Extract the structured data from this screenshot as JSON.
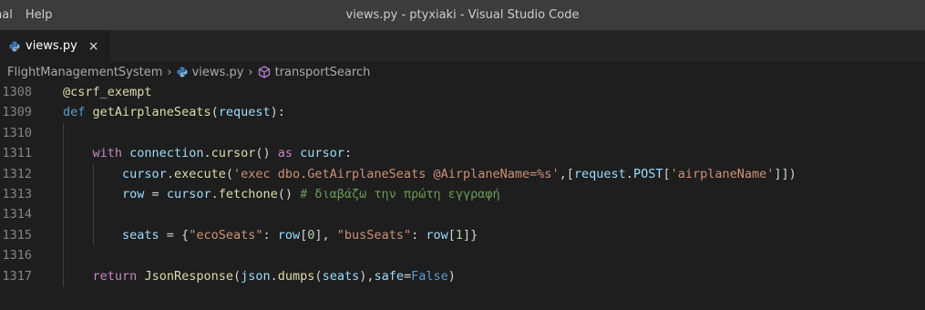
{
  "menu": [
    "nal",
    "Help"
  ],
  "window_title": "views.py - ptyxiaki - Visual Studio Code",
  "tab": {
    "label": "views.py",
    "close": "×"
  },
  "breadcrumb": {
    "folder": "FlightManagementSystem",
    "file": "views.py",
    "symbol": "transportSearch"
  },
  "colors": {
    "titlebar": "#3c3c3c",
    "editor_bg": "#1e1e1e",
    "python_icon": "#3a7cbf"
  },
  "code_lines": [
    {
      "num": "1308",
      "indent": 0,
      "tokens": [
        {
          "t": "@csrf_exempt",
          "c": "fn"
        }
      ]
    },
    {
      "num": "1309",
      "indent": 0,
      "tokens": [
        {
          "t": "def",
          "c": "kw"
        },
        {
          "t": " ",
          "c": "pl"
        },
        {
          "t": "getAirplaneSeats",
          "c": "fn"
        },
        {
          "t": "(",
          "c": "pl"
        },
        {
          "t": "request",
          "c": "var"
        },
        {
          "t": "):",
          "c": "pl"
        }
      ]
    },
    {
      "num": "1310",
      "indent": 1,
      "tokens": []
    },
    {
      "num": "1311",
      "indent": 1,
      "tokens": [
        {
          "t": "    ",
          "c": "pl"
        },
        {
          "t": "with",
          "c": "ctl"
        },
        {
          "t": " ",
          "c": "pl"
        },
        {
          "t": "connection",
          "c": "var"
        },
        {
          "t": ".",
          "c": "pl"
        },
        {
          "t": "cursor",
          "c": "fn"
        },
        {
          "t": "() ",
          "c": "pl"
        },
        {
          "t": "as",
          "c": "ctl"
        },
        {
          "t": " ",
          "c": "pl"
        },
        {
          "t": "cursor",
          "c": "var"
        },
        {
          "t": ":",
          "c": "pl"
        }
      ]
    },
    {
      "num": "1312",
      "indent": 2,
      "tokens": [
        {
          "t": "        ",
          "c": "pl"
        },
        {
          "t": "cursor",
          "c": "var"
        },
        {
          "t": ".",
          "c": "pl"
        },
        {
          "t": "execute",
          "c": "fn"
        },
        {
          "t": "(",
          "c": "pl"
        },
        {
          "t": "'exec dbo.GetAirplaneSeats @AirplaneName=%s'",
          "c": "str"
        },
        {
          "t": ",[",
          "c": "pl"
        },
        {
          "t": "request",
          "c": "var"
        },
        {
          "t": ".",
          "c": "pl"
        },
        {
          "t": "POST",
          "c": "var"
        },
        {
          "t": "[",
          "c": "pl"
        },
        {
          "t": "'airplaneName'",
          "c": "str"
        },
        {
          "t": "]])",
          "c": "pl"
        }
      ]
    },
    {
      "num": "1313",
      "indent": 2,
      "tokens": [
        {
          "t": "        ",
          "c": "pl"
        },
        {
          "t": "row",
          "c": "var"
        },
        {
          "t": " = ",
          "c": "pl"
        },
        {
          "t": "cursor",
          "c": "var"
        },
        {
          "t": ".",
          "c": "pl"
        },
        {
          "t": "fetchone",
          "c": "fn"
        },
        {
          "t": "() ",
          "c": "pl"
        },
        {
          "t": "# διαβάζω την πρώτη εγγραφή",
          "c": "cmt"
        }
      ]
    },
    {
      "num": "1314",
      "indent": 2,
      "tokens": []
    },
    {
      "num": "1315",
      "indent": 2,
      "tokens": [
        {
          "t": "        ",
          "c": "pl"
        },
        {
          "t": "seats",
          "c": "var"
        },
        {
          "t": " = {",
          "c": "pl"
        },
        {
          "t": "\"ecoSeats\"",
          "c": "str"
        },
        {
          "t": ": ",
          "c": "pl"
        },
        {
          "t": "row",
          "c": "var"
        },
        {
          "t": "[",
          "c": "pl"
        },
        {
          "t": "0",
          "c": "num"
        },
        {
          "t": "], ",
          "c": "pl"
        },
        {
          "t": "\"busSeats\"",
          "c": "str"
        },
        {
          "t": ": ",
          "c": "pl"
        },
        {
          "t": "row",
          "c": "var"
        },
        {
          "t": "[",
          "c": "pl"
        },
        {
          "t": "1",
          "c": "num"
        },
        {
          "t": "]}",
          "c": "pl"
        }
      ]
    },
    {
      "num": "1316",
      "indent": 1,
      "tokens": []
    },
    {
      "num": "1317",
      "indent": 1,
      "tokens": [
        {
          "t": "    ",
          "c": "pl"
        },
        {
          "t": "return",
          "c": "ctl"
        },
        {
          "t": " ",
          "c": "pl"
        },
        {
          "t": "JsonResponse",
          "c": "fn"
        },
        {
          "t": "(",
          "c": "pl"
        },
        {
          "t": "json",
          "c": "var"
        },
        {
          "t": ".",
          "c": "pl"
        },
        {
          "t": "dumps",
          "c": "fn"
        },
        {
          "t": "(",
          "c": "pl"
        },
        {
          "t": "seats",
          "c": "var"
        },
        {
          "t": "),",
          "c": "pl"
        },
        {
          "t": "safe",
          "c": "var"
        },
        {
          "t": "=",
          "c": "pl"
        },
        {
          "t": "False",
          "c": "kw"
        },
        {
          "t": ")",
          "c": "pl"
        }
      ]
    }
  ]
}
